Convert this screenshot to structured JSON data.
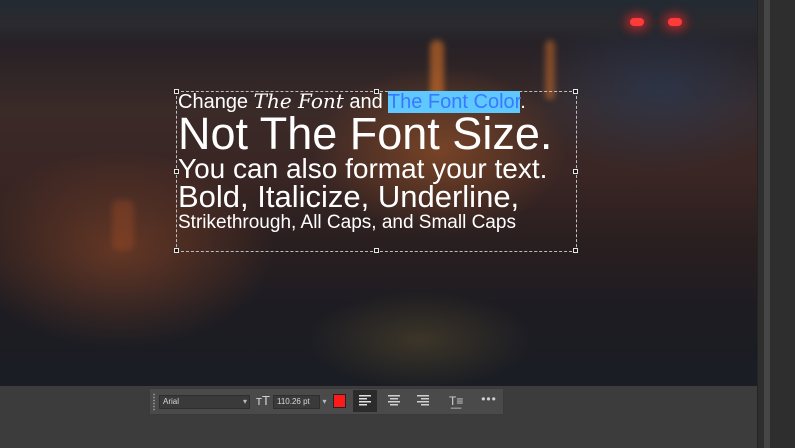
{
  "canvas": {
    "text_lines": {
      "line1_part1": "Change ",
      "line1_script": "The Font",
      "line1_part2": " and ",
      "line1_highlight": "The Font Color",
      "line1_end": ".",
      "line2": "Not The Font Size.",
      "line3": "You can also format your text.",
      "line4": "Bold, Italicize, Underline,",
      "line5": "Strikethrough, All Caps, and Small Caps"
    }
  },
  "toolbar": {
    "font_family": "Arial",
    "font_size": "110.26 pt",
    "color": "#ff1a1a",
    "icons": [
      "font-size-icon",
      "align-left-icon",
      "align-center-icon",
      "align-right-icon",
      "text-options-icon",
      "more-icon"
    ]
  }
}
